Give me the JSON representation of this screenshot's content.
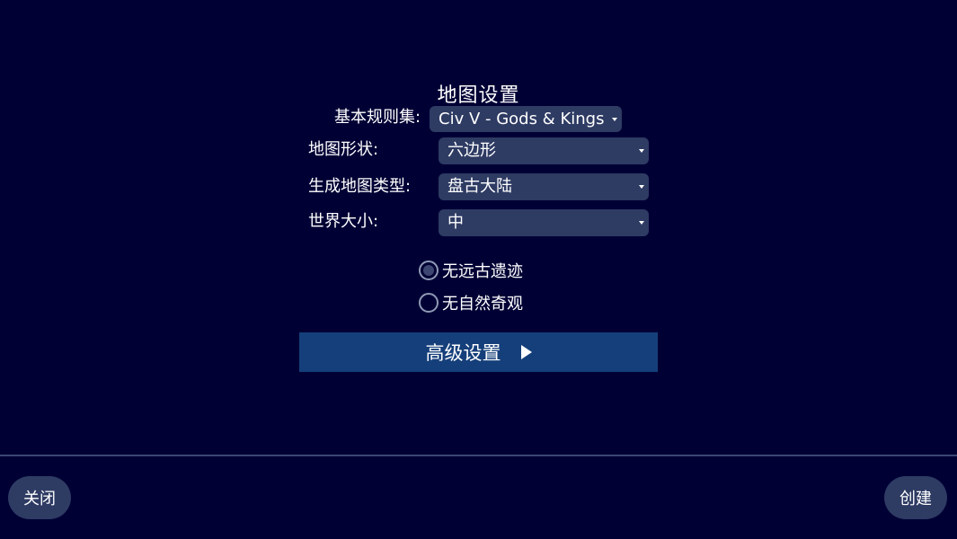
{
  "title": "地图设置",
  "fields": [
    {
      "label": "基本规则集:",
      "value": "Civ V - Gods & Kings"
    },
    {
      "label": "地图形状:",
      "value": "六边形"
    },
    {
      "label": "生成地图类型:",
      "value": "盘古大陆"
    },
    {
      "label": "世界大小:",
      "value": "中"
    }
  ],
  "options": [
    {
      "label": "无远古遗迹"
    },
    {
      "label": "无自然奇观"
    }
  ],
  "advanced_label": "高级设置",
  "footer": {
    "close_label": "关闭",
    "create_label": "创建"
  }
}
